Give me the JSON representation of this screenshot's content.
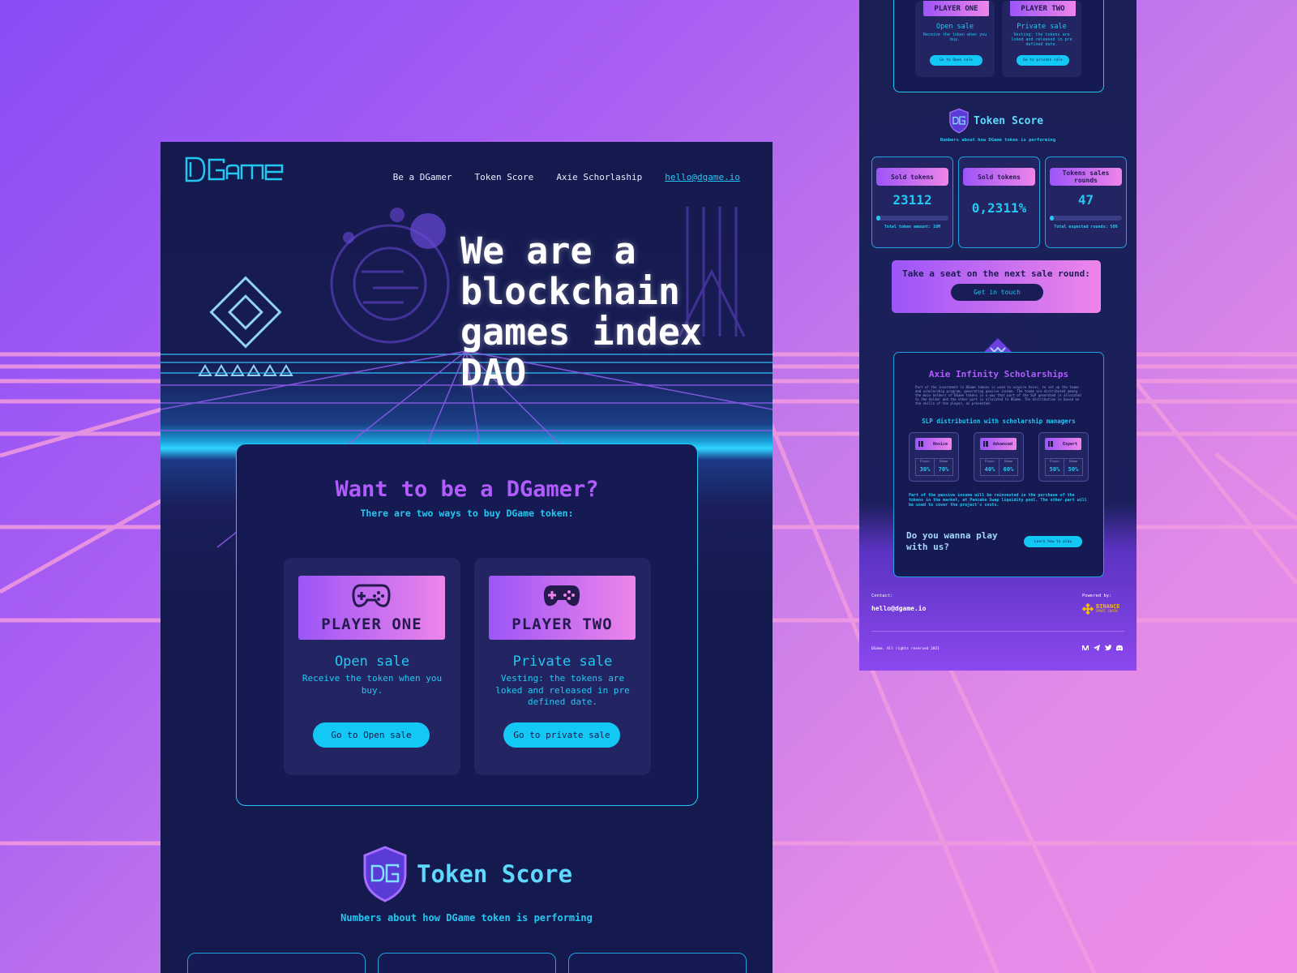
{
  "colors": {
    "accent": "#22c8f2",
    "purple": "#b25cff",
    "bg_dark": "#151a4e",
    "gradient_start": "#9c55f7",
    "gradient_end": "#ee85ea"
  },
  "header": {
    "logo_text": "DGame",
    "nav": [
      "Be a DGamer",
      "Token Score",
      "Axie Schorlaship"
    ],
    "email": "hello@dgame.io"
  },
  "hero": {
    "title": "We are a blockchain games index DAO"
  },
  "buy": {
    "title": "Want to be a DGamer?",
    "subtitle": "There are two ways to buy DGame token:",
    "players": [
      {
        "banner": "PLAYER ONE",
        "icon": "gamepad-outline-icon",
        "sale": "Open sale",
        "desc": "Receive the token when you buy.",
        "button": "Go to Open sale"
      },
      {
        "banner": "PLAYER TWO",
        "icon": "gamepad-filled-icon",
        "sale": "Private sale",
        "desc": "Vesting: the tokens are loked and released in pre defined date.",
        "button": "Go to private sale"
      }
    ]
  },
  "token_score": {
    "title": "Token Score",
    "subtitle": "Numbers about how DGame token is performing"
  },
  "right": {
    "players": [
      {
        "banner": "PLAYER ONE",
        "sale": "Open sale",
        "desc": "Receive the token when you buy.",
        "button": "Go to Open sale"
      },
      {
        "banner": "PLAYER TWO",
        "sale": "Private sale",
        "desc": "Vesting: the tokens are loked and released in pre defined date.",
        "button": "Go to private sale"
      }
    ],
    "token_score": {
      "title": "Token Score",
      "subtitle": "Numbers about how DGame token is performing"
    },
    "stats": [
      {
        "label": "Sold tokens",
        "value": "23112",
        "progress": 0.05,
        "note": "Total token amount: 10M"
      },
      {
        "label": "Sold tokens",
        "value": "0,2311%",
        "progress": null,
        "note": ""
      },
      {
        "label": "Tokens sales rounds",
        "value": "47",
        "progress": 0.05,
        "note": "Total expected rounds: 500"
      }
    ],
    "cta": {
      "text": "Take a seat on the next sale round:",
      "button": "Get in touch"
    },
    "axie": {
      "title": "Axie Infinity Scholarships",
      "body": "Part of the investment in DGame tokens is used to acquire Axies, to set up the teams and scholarship program, generating passive income. The teams are distributed among the main holders of DGame tokens in a way that part of the SLP generated is allocated to the holder and the other part is allocated to DGame. The distribution is based on the skills of the player, as presented:",
      "subtitle": "SLP distribution with scholarship managers",
      "tiers": [
        {
          "name": "Novice",
          "player_label": "Player",
          "dgame_label": "DGame",
          "player": "30%",
          "dgame": "70%"
        },
        {
          "name": "Advanced",
          "player_label": "Player",
          "dgame_label": "DGame",
          "player": "40%",
          "dgame": "60%"
        },
        {
          "name": "Expert",
          "player_label": "Player",
          "dgame_label": "DGame",
          "player": "50%",
          "dgame": "50%"
        }
      ],
      "foot": "Part of the passive income will be reinvested in the purchase of the tokens in the market, at Pancake Swap liquidity pool. The other part will be used to cover the project's costs."
    },
    "play": {
      "text": "Do you wanna play with us?",
      "button": "Learn how to play"
    },
    "footer": {
      "contact_label": "Contact:",
      "email": "hello@dgame.io",
      "powered_label": "Powered by:",
      "powered_name": "BINANCE",
      "powered_sub": "SMART CHAIN",
      "rights": "DGame. All rights reserved 2021",
      "social": [
        "medium-icon",
        "telegram-icon",
        "twitter-icon",
        "discord-icon"
      ]
    }
  }
}
